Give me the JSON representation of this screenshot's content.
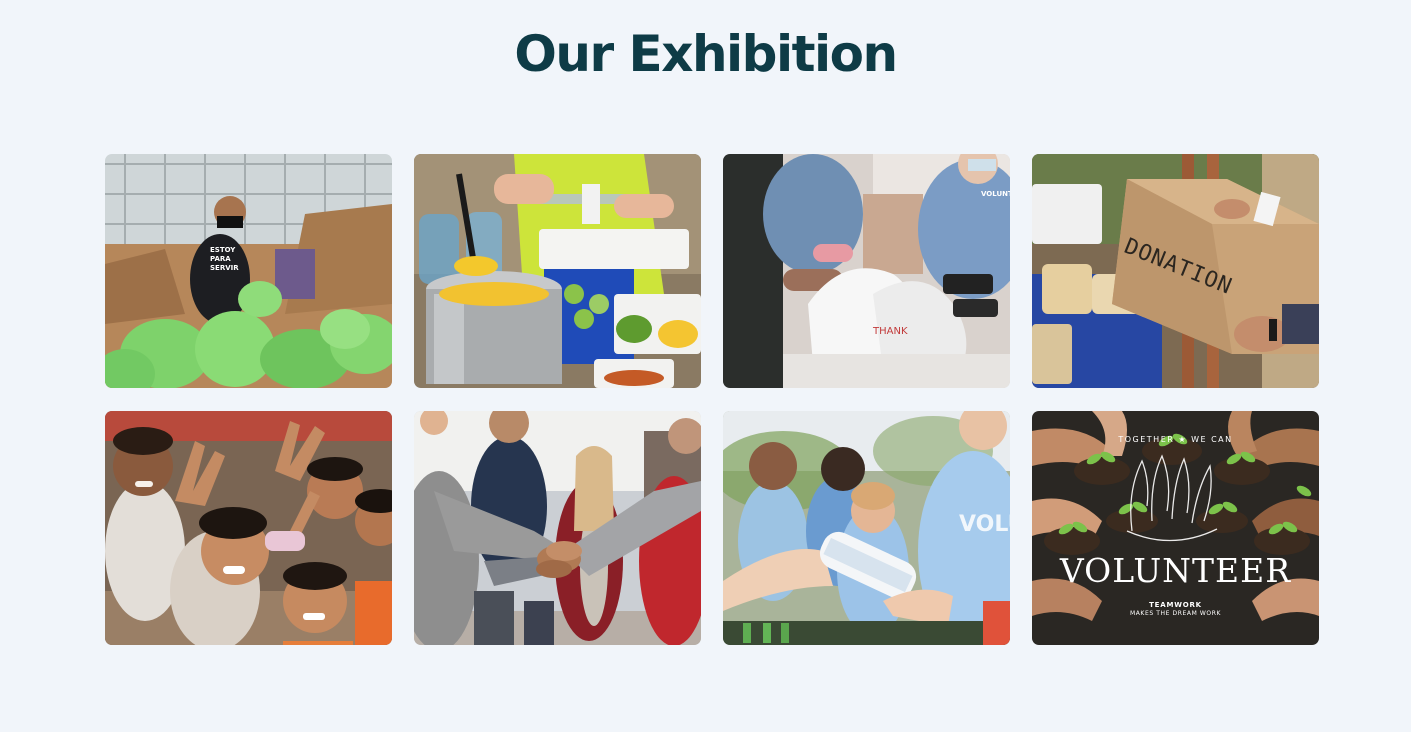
{
  "section": {
    "title": "Our Exhibition"
  },
  "gallery": {
    "tiles": [
      {
        "subject": "volunteer-packing-food-bags",
        "shirt_text": [
          "ESTOY",
          "PARA",
          "SERVIR"
        ]
      },
      {
        "subject": "food-serving-ladle-pot"
      },
      {
        "subject": "volunteers-handing-out-bags",
        "shirt_text": "VOLUNTEER"
      },
      {
        "subject": "donation-box",
        "box_text": "DONATION"
      },
      {
        "subject": "smiling-children-peace-signs"
      },
      {
        "subject": "team-hands-together"
      },
      {
        "subject": "volunteer-giving-bottle",
        "shirt_text": "VOLUN"
      },
      {
        "subject": "volunteer-poster-hands-plants",
        "poster_top": "TOGETHER  ★  WE CAN",
        "poster_title": "VOLUNTEER",
        "poster_sub1": "TEAMWORK",
        "poster_sub2": "MAKES THE DREAM WORK"
      }
    ]
  }
}
